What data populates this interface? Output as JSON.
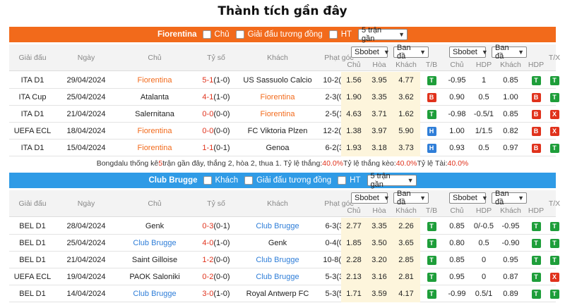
{
  "page_title": "Thành tích gần đây",
  "colors": {
    "fiorentina_bar": "#f26a1b",
    "brugge_bar": "#2f9be6",
    "win": "#1e9e3a",
    "lose": "#e0321c",
    "draw": "#2f7ed8"
  },
  "headers": {
    "league": "Giải đấu",
    "date": "Ngày",
    "home": "Chủ",
    "score": "Tỷ số",
    "away": "Khách",
    "corner": "Phạt góc",
    "odds_select1": "Sbobet",
    "odds_select2": "Ban đầ",
    "handicap_select1": "Sbobet",
    "handicap_select2": "Ban đầ",
    "sub_home": "Chủ",
    "sub_draw": "Hòa",
    "sub_away": "Khách",
    "sub_tb": "T/B",
    "sub_home2": "Chủ",
    "sub_hdp": "HDP",
    "sub_away2": "Khách",
    "sub_hdp2": "HDP",
    "tx": "T/X"
  },
  "fiorentina": {
    "bar": {
      "team": "Fiorentina",
      "opt_home": "Chủ",
      "opt_same": "Giải đấu tương đồng",
      "opt_ht": "HT",
      "select": "5 trận gần"
    },
    "rows": [
      {
        "league": "ITA D1",
        "date": "29/04/2024",
        "home": "Fiorentina",
        "score": "5-1",
        "ht": "(1-0)",
        "away": "US Sassuolo Calcio",
        "corner": "10-2(5-1)",
        "o1": "1.56",
        "o2": "3.95",
        "o3": "4.77",
        "tb": "T",
        "h1": "-0.95",
        "hdp": "1",
        "h2": "0.85",
        "hdp_r": "T",
        "tx": "T"
      },
      {
        "league": "ITA Cup",
        "date": "25/04/2024",
        "home": "Atalanta",
        "score": "4-1",
        "ht": "(1-0)",
        "away": "Fiorentina",
        "corner": "2-3(0-3)",
        "o1": "1.90",
        "o2": "3.35",
        "o3": "3.62",
        "tb": "B",
        "h1": "0.90",
        "hdp": "0.5",
        "h2": "1.00",
        "hdp_r": "B",
        "tx": "T"
      },
      {
        "league": "ITA D1",
        "date": "21/04/2024",
        "home": "Salernitana",
        "score": "0-0",
        "ht": "(0-0)",
        "away": "Fiorentina",
        "corner": "2-5(1-3)",
        "o1": "4.63",
        "o2": "3.71",
        "o3": "1.62",
        "tb": "T",
        "h1": "-0.98",
        "hdp": "-0.5/1",
        "h2": "0.85",
        "hdp_r": "B",
        "tx": "X"
      },
      {
        "league": "UEFA ECL",
        "date": "18/04/2024",
        "home": "Fiorentina",
        "score": "0-0",
        "ht": "(0-0)",
        "away": "FC Viktoria Plzen",
        "corner": "12-2(5-1)",
        "o1": "1.38",
        "o2": "3.97",
        "o3": "5.90",
        "tb": "H",
        "h1": "1.00",
        "hdp": "1/1.5",
        "h2": "0.82",
        "hdp_r": "B",
        "tx": "X"
      },
      {
        "league": "ITA D1",
        "date": "15/04/2024",
        "home": "Fiorentina",
        "score": "1-1",
        "ht": "(0-1)",
        "away": "Genoa",
        "corner": "6-2(3-1)",
        "o1": "1.93",
        "o2": "3.18",
        "o3": "3.73",
        "tb": "H",
        "h1": "0.93",
        "hdp": "0.5",
        "h2": "0.97",
        "hdp_r": "B",
        "tx": "T"
      }
    ],
    "summary": {
      "prefix": "Bongdalu thống kê ",
      "count": "5",
      "mid": " trận gần đây, thắng 2, hòa 2, thua 1. Tỷ lệ thắng: ",
      "win_rate": "40.0%",
      "mid2": " Tỷ lệ thắng kèo: ",
      "kèo_rate": "40.0%",
      "mid3": " Tỷ lệ Tài: ",
      "tai_rate": "40.0%"
    }
  },
  "brugge": {
    "bar": {
      "team": "Club Brugge",
      "opt_away": "Khách",
      "opt_same": "Giải đấu tương đồng",
      "opt_ht": "HT",
      "select": "5 trận gần"
    },
    "rows": [
      {
        "league": "BEL D1",
        "date": "28/04/2024",
        "home": "Genk",
        "score": "0-3",
        "ht": "(0-1)",
        "away": "Club Brugge",
        "corner": "6-3(3-1)",
        "o1": "2.77",
        "o2": "3.35",
        "o3": "2.26",
        "tb": "T",
        "h1": "0.85",
        "hdp": "0/-0.5",
        "h2": "-0.95",
        "hdp_r": "T",
        "tx": "T"
      },
      {
        "league": "BEL D1",
        "date": "25/04/2024",
        "home": "Club Brugge",
        "score": "4-0",
        "ht": "(1-0)",
        "away": "Genk",
        "corner": "0-4(0-2)",
        "o1": "1.85",
        "o2": "3.50",
        "o3": "3.65",
        "tb": "T",
        "h1": "0.80",
        "hdp": "0.5",
        "h2": "-0.90",
        "hdp_r": "T",
        "tx": "T"
      },
      {
        "league": "BEL D1",
        "date": "21/04/2024",
        "home": "Saint Gilloise",
        "score": "1-2",
        "ht": "(0-0)",
        "away": "Club Brugge",
        "corner": "10-8(6-3)",
        "o1": "2.28",
        "o2": "3.20",
        "o3": "2.85",
        "tb": "T",
        "h1": "0.85",
        "hdp": "0",
        "h2": "0.95",
        "hdp_r": "T",
        "tx": "T"
      },
      {
        "league": "UEFA ECL",
        "date": "19/04/2024",
        "home": "PAOK Saloniki",
        "score": "0-2",
        "ht": "(0-0)",
        "away": "Club Brugge",
        "corner": "5-3(3-1)",
        "o1": "2.13",
        "o2": "3.16",
        "o3": "2.81",
        "tb": "T",
        "h1": "0.95",
        "hdp": "0",
        "h2": "0.87",
        "hdp_r": "T",
        "tx": "X"
      },
      {
        "league": "BEL D1",
        "date": "14/04/2024",
        "home": "Club Brugge",
        "score": "3-0",
        "ht": "(1-0)",
        "away": "Royal Antwerp FC",
        "corner": "5-3(5-0)",
        "o1": "1.71",
        "o2": "3.59",
        "o3": "4.17",
        "tb": "T",
        "h1": "-0.99",
        "hdp": "0.5/1",
        "h2": "0.89",
        "hdp_r": "T",
        "tx": "T"
      }
    ]
  }
}
